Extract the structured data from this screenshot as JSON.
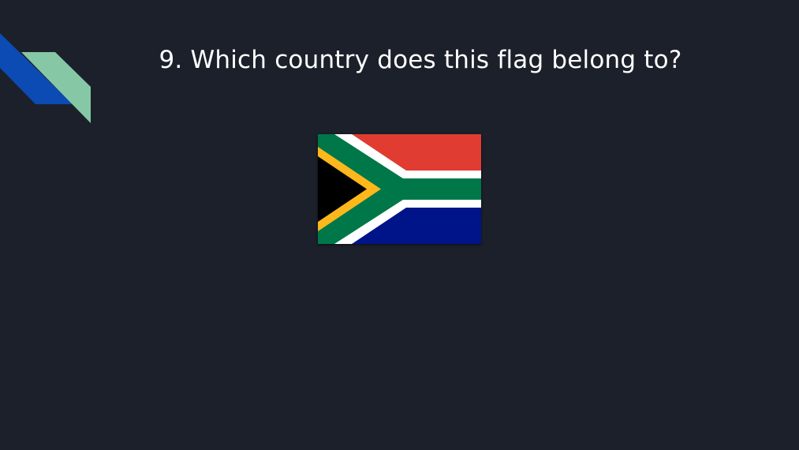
{
  "slide": {
    "title": "9. Which country does this flag belong to?",
    "background_color": "#1c202b"
  },
  "decoration": {
    "icon": "diagonal-ribbon-icon",
    "colors": {
      "blue": "#0b4bb3",
      "green": "#86c8a6"
    }
  },
  "flag": {
    "icon": "south-africa-flag-icon",
    "colors": {
      "red": "#e03c31",
      "blue": "#001489",
      "green": "#007749",
      "white": "#ffffff",
      "gold": "#ffb81c",
      "black": "#000000"
    }
  }
}
